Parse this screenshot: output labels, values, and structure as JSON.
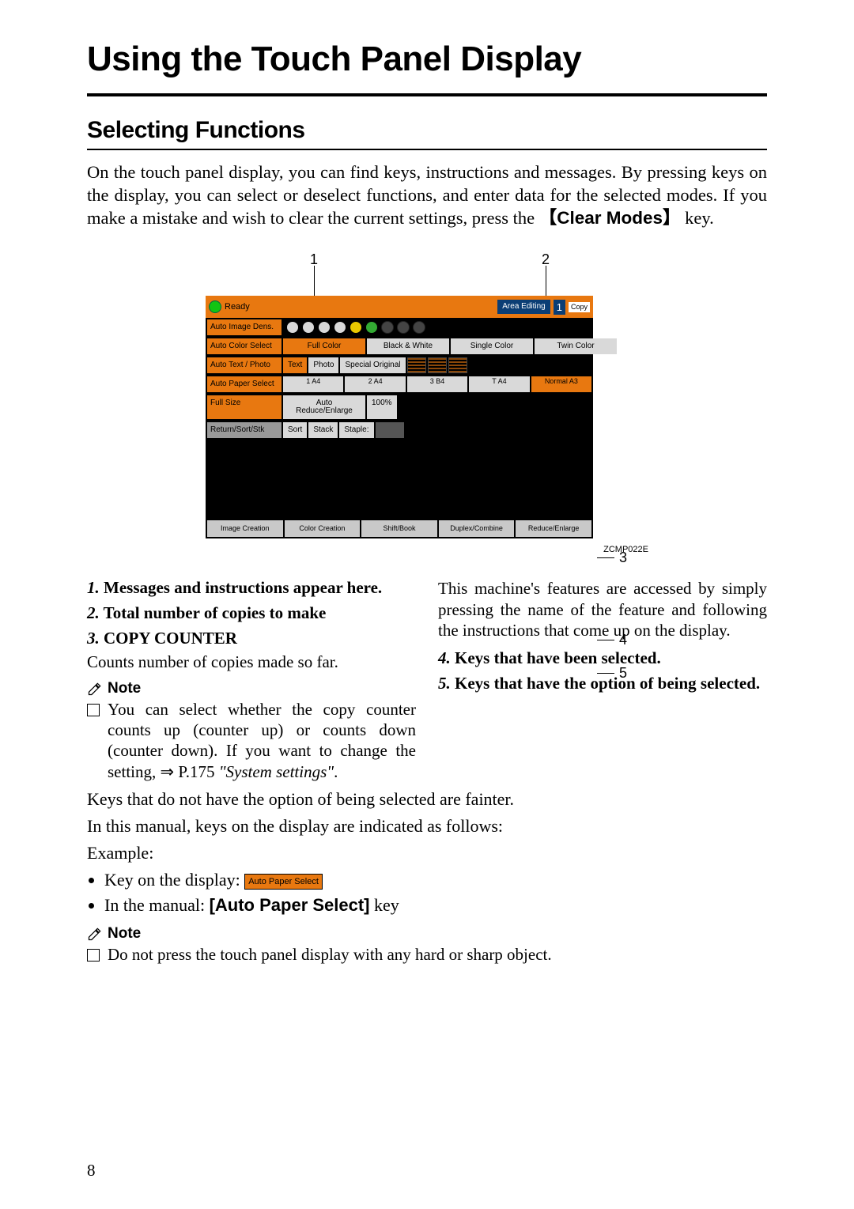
{
  "page": {
    "title": "Using the Touch Panel Display",
    "section": "Selecting Functions",
    "page_number": "8"
  },
  "intro": {
    "text_pre": "On the touch panel display, you can find keys, instructions and messages. By pressing keys on the display, you can select or deselect functions, and enter data for the selected modes. If you make a mistake and wish to clear the current settings, press the ",
    "cm_open": "【",
    "cm_label": "Clear Modes",
    "cm_close": "】",
    "text_post": " key."
  },
  "figure": {
    "callouts": {
      "c1": "1",
      "c2": "2",
      "c3": "3",
      "c4": "4",
      "c5": "5"
    },
    "id": "ZCMP022E",
    "status": "Ready",
    "area_editing": "Area Editing",
    "copy_count": "1",
    "copy_ctr_label": "Copy",
    "row_labels": {
      "aid": "Auto Image Dens.",
      "acs": "Auto Color Select",
      "atp": "Auto Text / Photo",
      "aps": "Auto Paper Select",
      "fs": "Full Size",
      "fin": "Return/Sort/Stk"
    },
    "color_keys": [
      "Full Color",
      "Black & White",
      "Single Color",
      "Twin Color"
    ],
    "orig_keys": [
      "Text",
      "Photo",
      "Special Original"
    ],
    "paper_trays": [
      "1 A4",
      "2 A4",
      "3 B4",
      "T A4",
      "Normal A3"
    ],
    "size_keys": [
      "Auto Reduce/Enlarge",
      "100%"
    ],
    "finish_keys": [
      "Sort",
      "Stack",
      "Staple:"
    ],
    "bottom_tabs": [
      "Image Creation",
      "Color Creation",
      "Shift/Book",
      "Duplex/Combine",
      "Reduce/Enlarge"
    ]
  },
  "legend": {
    "i1": {
      "n": "1.",
      "t": " Messages and instructions appear here."
    },
    "i2": {
      "n": "2.",
      "t": " Total number of copies to make"
    },
    "i3": {
      "n": "3.",
      "t": " COPY COUNTER"
    },
    "i3_sub": "Counts number of copies made so far.",
    "note_label": "Note",
    "note1_text": "You can select whether the copy counter counts up (counter up) or counts down (counter down). If you want to change the setting, ",
    "note1_arrow": "⇒",
    "note1_ref": " P.175 ",
    "note1_ital": "\"System settings\"",
    "note1_tail": ".",
    "i3_para": "This machine's features are accessed by simply pressing the name of the feature and following the instructions that come up on the display.",
    "i4": {
      "n": "4.",
      "t": " Keys that have been selected."
    },
    "i5": {
      "n": "5.",
      "t": " Keys that have the option of being selected."
    }
  },
  "after": {
    "p1": "Keys that do not have the option of being selected are fainter.",
    "p2": "In this manual, keys on the display are indicated as follows:",
    "p3": "Example:",
    "b1_pre": "Key on the display: ",
    "b1_key": "Auto Paper Select",
    "b2_pre": "In the manual: ",
    "b2_key": "[Auto Paper Select]",
    "b2_post": " key",
    "note_label": "Note",
    "note2": "Do not press the touch panel display with any hard or sharp object."
  }
}
